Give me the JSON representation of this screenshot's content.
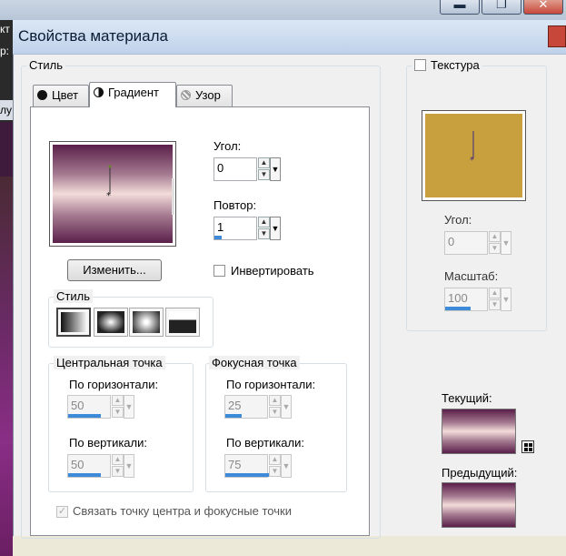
{
  "background": {
    "left_fragments": [
      "кт",
      "р:",
      "лу"
    ]
  },
  "window_buttons": {
    "minimize": "▬",
    "maximize": "❐",
    "close": "✕"
  },
  "dialog": {
    "title": "Свойства материала"
  },
  "style_group": {
    "label": "Стиль",
    "tabs": [
      {
        "label": "Цвет",
        "icon": "circle-icon"
      },
      {
        "label": "Градиент",
        "icon": "half-circle-icon"
      },
      {
        "label": "Узор",
        "icon": "pattern-icon"
      }
    ],
    "active_tab": "Градиент"
  },
  "gradient": {
    "colors": {
      "dark": "#5a1f4a",
      "mid": "#a57a90",
      "light": "#f3dcda"
    },
    "edit_button": "Изменить...",
    "angle": {
      "label": "Угол:",
      "value": "0",
      "fill": 0.0
    },
    "repeat": {
      "label": "Повтор:",
      "value": "1",
      "fill": 0.01
    },
    "invert": {
      "label": "Инвертировать",
      "checked": false
    },
    "style_sub": {
      "label": "Стиль",
      "options": [
        "linear",
        "rectangular",
        "sunburst",
        "radial"
      ],
      "selected": "linear"
    },
    "center_point": {
      "label": "Центральная точка",
      "horizontal": {
        "label": "По горизонтали:",
        "value": "50",
        "fill": 0.5
      },
      "vertical": {
        "label": "По вертикали:",
        "value": "50",
        "fill": 0.5
      }
    },
    "focal_point": {
      "label": "Фокусная точка",
      "horizontal": {
        "label": "По горизонтали:",
        "value": "25",
        "fill": 0.25
      },
      "vertical": {
        "label": "По вертикали:",
        "value": "75",
        "fill": 0.75
      }
    },
    "link": {
      "label": "Связать точку центра и фокусные точки",
      "checked": true,
      "disabled": true
    }
  },
  "texture": {
    "label": "Текстура",
    "checked": false,
    "color": "#c9a03e",
    "angle": {
      "label": "Угол:",
      "value": "0",
      "fill": 0.0
    },
    "scale": {
      "label": "Масштаб:",
      "value": "100",
      "fill": 0.5
    }
  },
  "current": {
    "label": "Текущий:"
  },
  "previous": {
    "label": "Предыдущий:"
  },
  "accent": "#3c8ad8"
}
